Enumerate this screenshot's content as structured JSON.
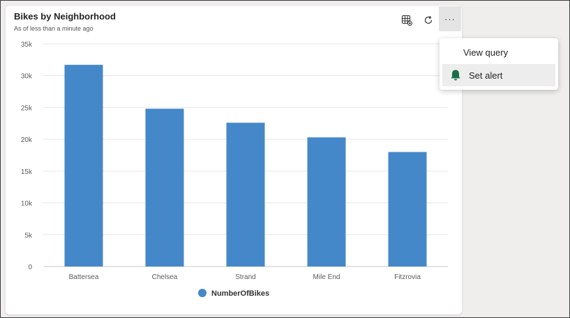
{
  "card": {
    "title": "Bikes by Neighborhood",
    "subtitle": "As of less than a minute ago"
  },
  "toolbar": {
    "table_icon": "table-view-icon",
    "refresh_icon": "refresh-icon",
    "more_label": "···"
  },
  "menu": {
    "items": [
      {
        "label": "View query"
      },
      {
        "label": "Set alert",
        "icon": "bell-icon",
        "icon_color": "#1b6e4a"
      }
    ]
  },
  "colors": {
    "bar": "#4488c9",
    "grid": "#e6e6e6",
    "axis_text": "#5c5c5c"
  },
  "chart_data": {
    "type": "bar",
    "categories": [
      "Battersea",
      "Chelsea",
      "Strand",
      "Mile End",
      "Fitzrovia"
    ],
    "series": [
      {
        "name": "NumberOfBikes",
        "values": [
          31700,
          24800,
          22600,
          20300,
          18000
        ]
      }
    ],
    "ylim": [
      0,
      35000
    ],
    "yticks": [
      "0",
      "5k",
      "10k",
      "15k",
      "20k",
      "25k",
      "30k",
      "35k"
    ],
    "legend": "bottom-center",
    "grid": true
  }
}
